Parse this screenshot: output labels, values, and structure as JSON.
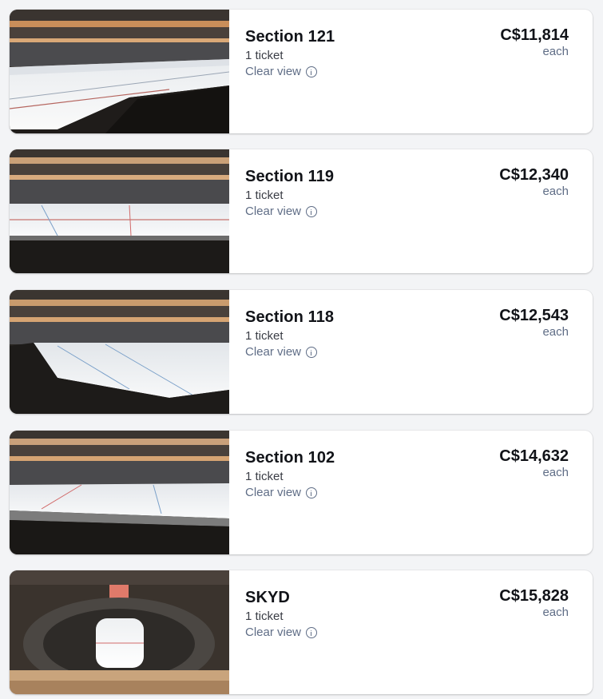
{
  "listings": [
    {
      "section": "Section 121",
      "quantity": "1 ticket",
      "view_label": "Clear view",
      "price": "C$11,814",
      "unit": "each",
      "image_icon": "arena-view-image"
    },
    {
      "section": "Section 119",
      "quantity": "1 ticket",
      "view_label": "Clear view",
      "price": "C$12,340",
      "unit": "each",
      "image_icon": "arena-view-image"
    },
    {
      "section": "Section 118",
      "quantity": "1 ticket",
      "view_label": "Clear view",
      "price": "C$12,543",
      "unit": "each",
      "image_icon": "arena-view-image"
    },
    {
      "section": "Section 102",
      "quantity": "1 ticket",
      "view_label": "Clear view",
      "price": "C$14,632",
      "unit": "each",
      "image_icon": "arena-view-image"
    },
    {
      "section": "SKYD",
      "quantity": "1 ticket",
      "view_label": "Clear view",
      "price": "C$15,828",
      "unit": "each",
      "image_icon": "arena-overhead-view-image"
    }
  ],
  "colors": {
    "background": "#f3f4f6",
    "card": "#ffffff",
    "text": "#111318",
    "muted": "#5f6d86"
  }
}
